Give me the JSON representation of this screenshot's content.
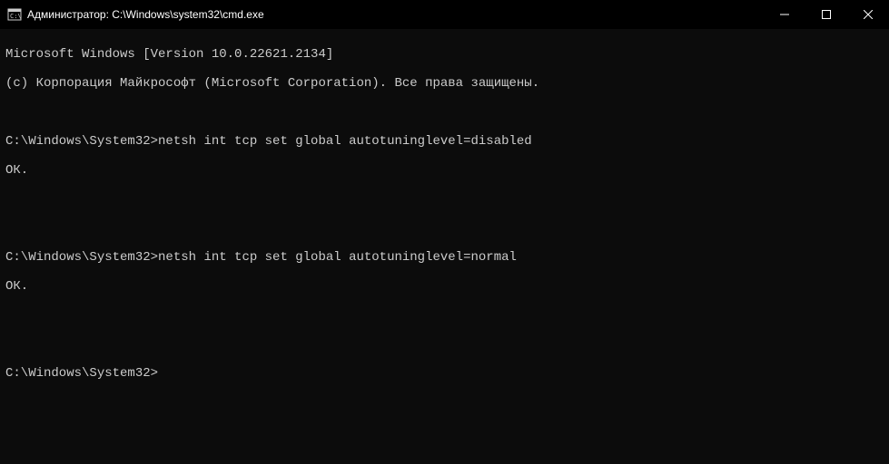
{
  "titlebar": {
    "title": "Администратор: C:\\Windows\\system32\\cmd.exe"
  },
  "terminal": {
    "line1": "Microsoft Windows [Version 10.0.22621.2134]",
    "line2": "(c) Корпорация Майкрософт (Microsoft Corporation). Все права защищены.",
    "blank1": "",
    "prompt1": "C:\\Windows\\System32>",
    "cmd1": "netsh int tcp set global autotuninglevel=disabled",
    "result1": "ОК.",
    "blank2": "",
    "blank3": "",
    "prompt2": "C:\\Windows\\System32>",
    "cmd2": "netsh int tcp set global autotuninglevel=normal",
    "result2": "ОК.",
    "blank4": "",
    "blank5": "",
    "prompt3": "C:\\Windows\\System32>"
  }
}
